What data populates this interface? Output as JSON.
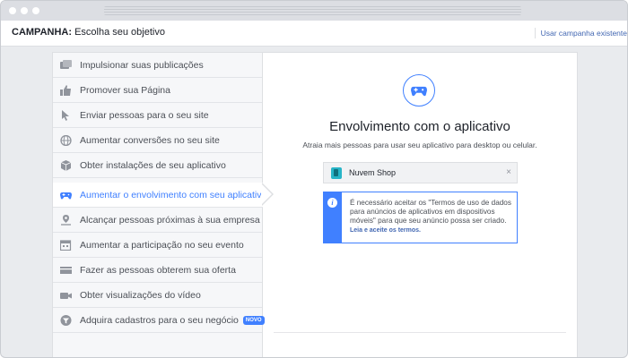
{
  "header": {
    "title_strong": "CAMPANHA:",
    "title_rest": " Escolha seu objetivo",
    "existing_link": "Usar campanha existente"
  },
  "objectives": [
    {
      "label": "Impulsionar suas publicações",
      "icon": "boost-posts-icon"
    },
    {
      "label": "Promover sua Página",
      "icon": "thumbs-up-icon"
    },
    {
      "label": "Enviar pessoas para o seu site",
      "icon": "cursor-icon"
    },
    {
      "label": "Aumentar conversões no seu site",
      "icon": "globe-icon"
    },
    {
      "label": "Obter instalações de seu aplicativo",
      "icon": "box-icon"
    },
    {
      "label": "Aumentar o envolvimento com seu aplicativo",
      "icon": "gamepad-icon",
      "selected": true
    },
    {
      "label": "Alcançar pessoas próximas à sua empresa",
      "icon": "map-pin-icon"
    },
    {
      "label": "Aumentar a participação no seu evento",
      "icon": "calendar-icon"
    },
    {
      "label": "Fazer as pessoas obterem sua oferta",
      "icon": "offer-icon"
    },
    {
      "label": "Obter visualizações do vídeo",
      "icon": "video-camera-icon"
    },
    {
      "label": "Adquira cadastros para o seu negócio",
      "icon": "filter-icon",
      "badge": "NOVO"
    }
  ],
  "detail": {
    "icon": "gamepad-icon",
    "title": "Envolvimento com o aplicativo",
    "subtitle": "Atraia mais pessoas para usar seu aplicativo para desktop ou celular.",
    "app_name": "Nuvem Shop",
    "remove_symbol": "×",
    "notice_text": "É necessário aceitar os \"Termos de uso de dados para anúncios de aplicativos em dispositivos móveis\" para que seu anúncio possa ser criado.",
    "notice_link": "Leia e aceite os termos."
  },
  "colors": {
    "accent": "#4080ff",
    "app_icon": "#27b4c7"
  }
}
